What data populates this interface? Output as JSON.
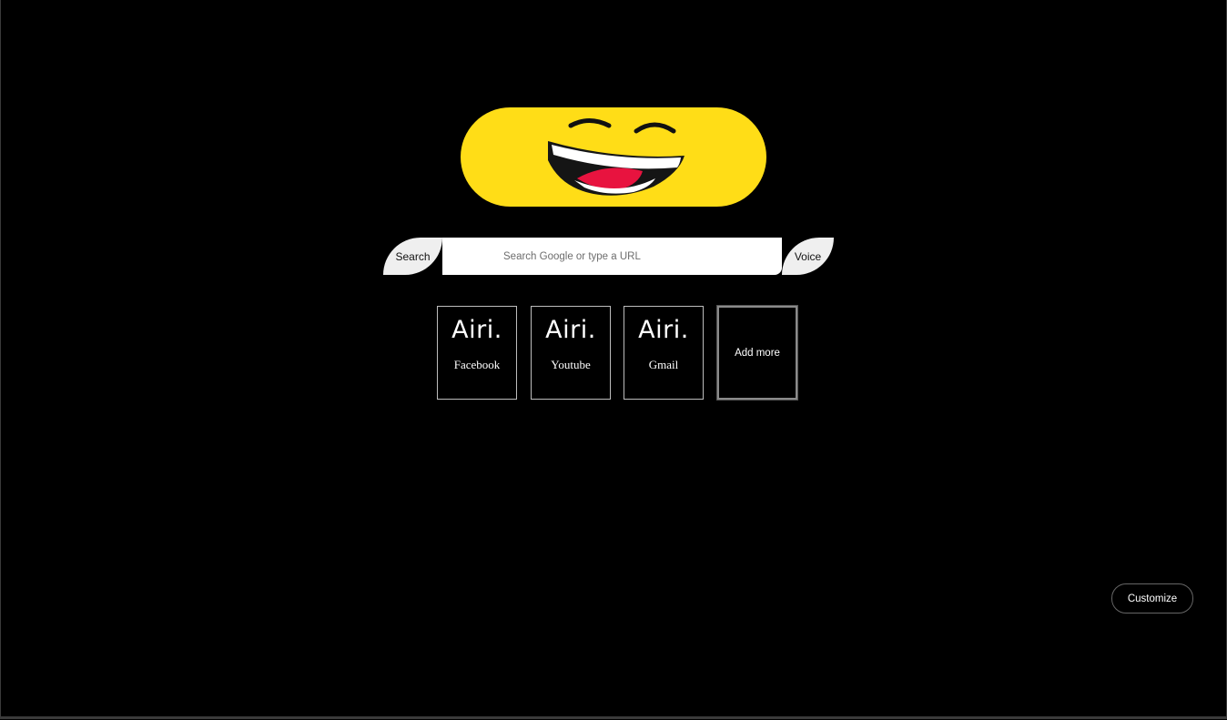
{
  "logo": {
    "name": "laughing-face-logo",
    "background": "#ffdd17"
  },
  "search": {
    "button_label": "Search",
    "placeholder": "Search Google or type a URL",
    "value": "",
    "voice_label": "Voice"
  },
  "shortcuts": [
    {
      "brand": "Airi.",
      "label": "Facebook"
    },
    {
      "brand": "Airi.",
      "label": "Youtube"
    },
    {
      "brand": "Airi.",
      "label": "Gmail"
    }
  ],
  "add_more_label": "Add more",
  "customize_label": "Customize",
  "colors": {
    "background": "#000000",
    "accent": "#ffdd17",
    "button": "#efefef"
  }
}
